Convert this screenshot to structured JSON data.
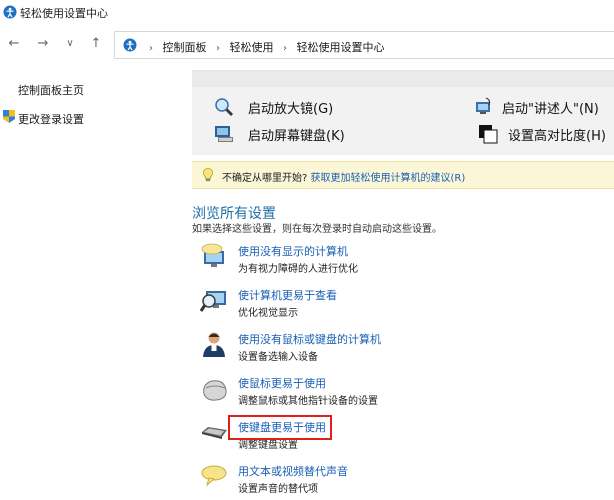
{
  "window": {
    "title": "轻松使用设置中心",
    "icon": "ease-of-access-icon"
  },
  "nav": {
    "back": "←",
    "forward": "→",
    "recent": "∨",
    "up": "↑",
    "breadcrumbs": [
      "控制面板",
      "轻松使用",
      "轻松使用设置中心"
    ],
    "separator": "›"
  },
  "left": {
    "home_link": "控制面板主页",
    "signin_link": "更改登录设置"
  },
  "quick": [
    {
      "label": "启动放大镜(G)",
      "icon": "magnifier-icon"
    },
    {
      "label": "启动\"讲述人\"(N)",
      "icon": "narrator-icon"
    },
    {
      "label": "启动屏幕键盘(K)",
      "icon": "onscreen-keyboard-icon"
    },
    {
      "label": "设置高对比度(H)",
      "icon": "high-contrast-icon"
    }
  ],
  "tip": {
    "prefix": "不确定从哪里开始?",
    "link": "获取更加轻松使用计算机的建议(R)"
  },
  "browse": {
    "title": "浏览所有设置",
    "subtitle": "如果选择这些设置，则在每次登录时自动启动这些设置。"
  },
  "items": [
    {
      "link": "使用没有显示的计算机",
      "desc": "为有视力障碍的人进行优化",
      "icon": "speech-display-icon"
    },
    {
      "link": "使计算机更易于查看",
      "desc": "优化视觉显示",
      "icon": "monitor-magnifier-icon"
    },
    {
      "link": "使用没有鼠标或键盘的计算机",
      "desc": "设置备选输入设备",
      "icon": "person-icon"
    },
    {
      "link": "使鼠标更易于使用",
      "desc": "调整鼠标或其他指针设备的设置",
      "icon": "mouse-icon"
    },
    {
      "link": "使键盘更易于使用",
      "desc": "调整键盘设置",
      "icon": "keyboard-icon"
    },
    {
      "link": "用文本或视频替代声音",
      "desc": "设置声音的替代项",
      "icon": "speech-bubble-icon"
    }
  ],
  "colors": {
    "link": "#1a5fb4",
    "section": "#1e6fa8",
    "tip_bg": "#fbf6d6",
    "highlight": "#e0201a"
  }
}
